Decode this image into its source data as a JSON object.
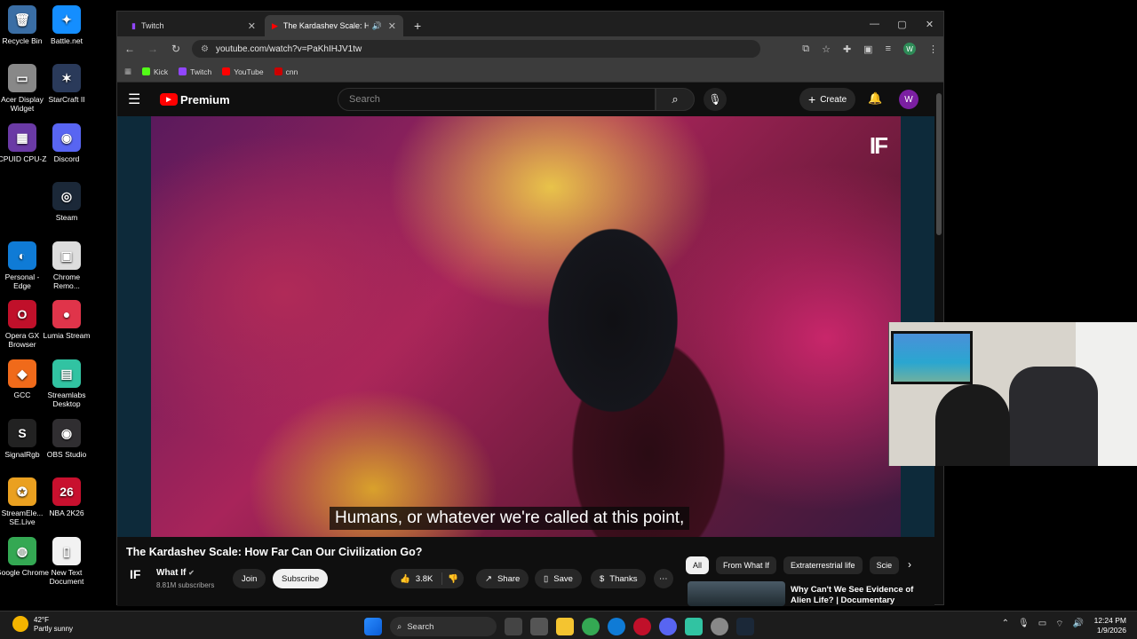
{
  "desktop": {
    "icons": [
      {
        "label": "Recycle Bin",
        "glyph": "🗑",
        "color": "#3a6ea5"
      },
      {
        "label": "Battle.net",
        "glyph": "✦",
        "color": "#148eff"
      },
      {
        "label": "Acer Display Widget",
        "glyph": "▭",
        "color": "#888888"
      },
      {
        "label": "StarCraft II",
        "glyph": "✶",
        "color": "#2a3a5a"
      },
      {
        "label": "CPUID CPU-Z",
        "glyph": "▦",
        "color": "#6a3aa5"
      },
      {
        "label": "Discord",
        "glyph": "◉",
        "color": "#5865f2"
      },
      {
        "label": "Steam",
        "glyph": "◎",
        "color": "#1b2838"
      },
      {
        "label": "Personal - Edge",
        "glyph": "◐",
        "color": "#0f7bd6"
      },
      {
        "label": "Chrome Remo...",
        "glyph": "▣",
        "color": "#dddddd"
      },
      {
        "label": "Opera GX Browser",
        "glyph": "O",
        "color": "#c0102a"
      },
      {
        "label": "Lumia Stream",
        "glyph": "●",
        "color": "#e0344a"
      },
      {
        "label": "GCC",
        "glyph": "◆",
        "color": "#f06a1a"
      },
      {
        "label": "Streamlabs Desktop",
        "glyph": "▤",
        "color": "#31c3a2"
      },
      {
        "label": "SignalRgb",
        "glyph": "S",
        "color": "#222222"
      },
      {
        "label": "OBS Studio",
        "glyph": "◉",
        "color": "#302e31"
      },
      {
        "label": "StreamEle... SE.Live",
        "glyph": "✪",
        "color": "#eaa020"
      },
      {
        "label": "NBA 2K26",
        "glyph": "26",
        "color": "#c8102e"
      },
      {
        "label": "Google Chrome",
        "glyph": "◍",
        "color": "#34a853"
      },
      {
        "label": "New Text Document",
        "glyph": "▯",
        "color": "#f2f2f2"
      }
    ]
  },
  "browser": {
    "tabs": [
      {
        "label": "Twitch"
      },
      {
        "label": "The Kardashev Scale: How F"
      }
    ],
    "url": "youtube.com/watch?v=PaKhIHJV1tw",
    "bookmarks": [
      {
        "label": "Kick",
        "color": "#53fc18"
      },
      {
        "label": "Twitch",
        "color": "#9146ff"
      },
      {
        "label": "YouTube",
        "color": "#ff0000"
      },
      {
        "label": "cnn",
        "color": "#cc0000"
      }
    ],
    "profile_initial": "W"
  },
  "youtube": {
    "logo_text": "Premium",
    "search_placeholder": "Search",
    "create_label": "Create",
    "avatar_initial": "W",
    "caption": "Humans, or whatever we're called at this point,",
    "overlay_logo": "IF",
    "video_title": "The Kardashev Scale: How Far Can Our Civilization Go?",
    "channel": {
      "name": "What If",
      "subscribers": "8.81M subscribers",
      "logo": "IF"
    },
    "buttons": {
      "join": "Join",
      "subscribe": "Subscribe",
      "likes": "3.8K",
      "share": "Share",
      "save": "Save",
      "thanks": "Thanks"
    },
    "chips": [
      "All",
      "From What If",
      "Extraterrestrial life",
      "Scie"
    ],
    "recommendation": {
      "title": "Why Can't We See Evidence of Alien Life? | Documentary"
    }
  },
  "taskbar": {
    "weather": {
      "temp": "42°F",
      "desc": "Partly sunny"
    },
    "search_label": "Search",
    "time": "12:24 PM",
    "date": "1/9/2026"
  }
}
